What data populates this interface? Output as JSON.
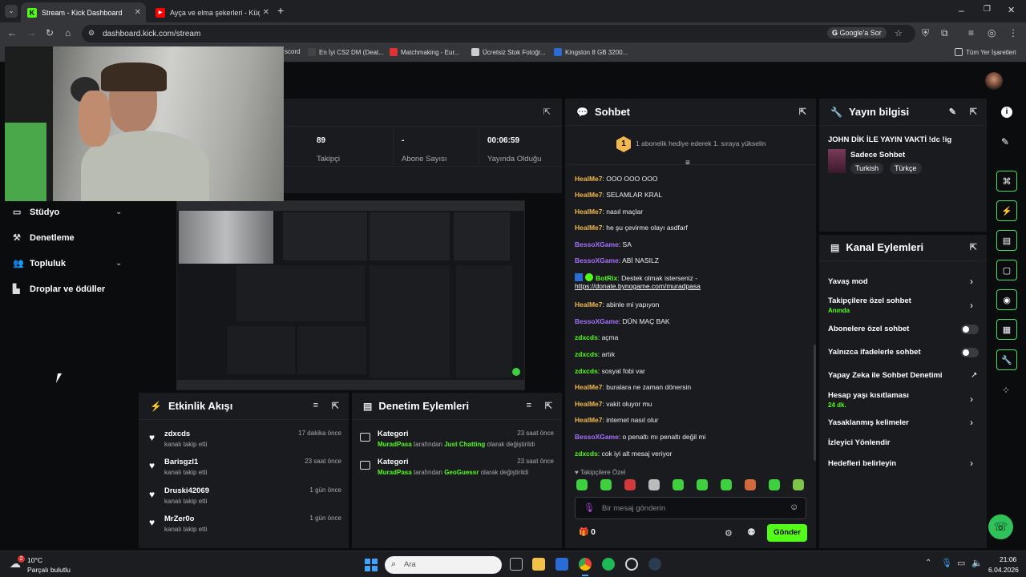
{
  "browser": {
    "tabs": [
      {
        "title": "Stream - Kick Dashboard",
        "active": true
      },
      {
        "title": "Ayça ve elma şekerleri - Küçük",
        "active": false
      }
    ],
    "new_tab": "+",
    "url": "dashboard.kick.com/stream",
    "search_engine": "Google'a Sor",
    "bookmarks": [
      "scord",
      "En İyi CS2 DM (Deat...",
      "Matchmaking - Eur...",
      "Ücretsiz Stok Fotoğr...",
      "Kingston 8 GB 3200..."
    ],
    "all_bookmarks": "Tüm Yer İşaretleri"
  },
  "sidebar": {
    "items": [
      {
        "label": "Stüdyo",
        "icon": "studio-icon"
      },
      {
        "label": "Denetleme",
        "icon": "hammer-icon"
      },
      {
        "label": "Topluluk",
        "icon": "users-icon"
      },
      {
        "label": "Droplar ve ödüller",
        "icon": "chart-icon"
      }
    ]
  },
  "stats": [
    {
      "value": "89",
      "label": "Takipçi"
    },
    {
      "value": "-",
      "label": "Abone Sayısı"
    },
    {
      "value": "00:06:59",
      "label": "Yayında Olduğu"
    }
  ],
  "chat": {
    "title": "Sohbet",
    "banner_rank": "1",
    "banner": "1 abonelik hediye ederek 1. sıraya yükselin",
    "messages": [
      {
        "user": "HealMe7",
        "color": "#f2b84b",
        "text": "OOO OOO OOO"
      },
      {
        "user": "HealMe7",
        "color": "#f2b84b",
        "text": "SELAMLAR KRAL"
      },
      {
        "user": "HealMe7",
        "color": "#f2b84b",
        "text": "nasıl maçlar"
      },
      {
        "user": "HealMe7",
        "color": "#f2b84b",
        "text": "he şu çevirme olayı asdfarf"
      },
      {
        "user": "BessoXGame",
        "color": "#a970ff",
        "text": "SA"
      },
      {
        "user": "BessoXGame",
        "color": "#a970ff",
        "text": "ABİ NASILZ"
      },
      {
        "user": "BotRix",
        "color": "#53fc18",
        "text": "Destek olmak isterseniz -",
        "link": "https://donate.bynogame.com/muradpasa"
      },
      {
        "user": "HealMe7",
        "color": "#f2b84b",
        "text": "abinle mi yapıyon"
      },
      {
        "user": "BessoXGame",
        "color": "#a970ff",
        "text": "DÜN MAÇ BAK"
      },
      {
        "user": "zdxcds",
        "color": "#53fc18",
        "text": "açma"
      },
      {
        "user": "zdxcds",
        "color": "#53fc18",
        "text": "artık"
      },
      {
        "user": "zdxcds",
        "color": "#53fc18",
        "text": "sosyal fobi var"
      },
      {
        "user": "HealMe7",
        "color": "#f2b84b",
        "text": "buralara ne zaman dönersin"
      },
      {
        "user": "HealMe7",
        "color": "#f2b84b",
        "text": "vakit oluyor mu"
      },
      {
        "user": "HealMe7",
        "color": "#f2b84b",
        "text": "internet nasıl olur"
      },
      {
        "user": "BessoXGame",
        "color": "#a970ff",
        "text": "o penaltı mı penaltı değil mi"
      },
      {
        "user": "zdxcds",
        "color": "#53fc18",
        "text": "cok iyi alt mesaj veriyor"
      }
    ],
    "followers_only": "Takipçilere Özel",
    "input_placeholder": "Bir mesaj gönderin",
    "count": "0",
    "send": "Gönder"
  },
  "stream_info": {
    "title": "Yayın bilgisi",
    "stream_title": "JOHN DİK İLE YAYIN VAKTİ !dc !ig",
    "category": "Sadece Sohbet",
    "tags": [
      "Turkish",
      "Türkçe"
    ]
  },
  "channel_actions": {
    "title": "Kanal Eylemleri",
    "items": [
      {
        "label": "Yavaş mod",
        "control": "chevron"
      },
      {
        "label": "Takipçilere özel sohbet",
        "sub": "Anında",
        "control": "chevron"
      },
      {
        "label": "Abonelere özel sohbet",
        "control": "toggle"
      },
      {
        "label": "Yalnızca ifadelerle sohbet",
        "control": "toggle"
      },
      {
        "label": "Yapay Zeka ile Sohbet Denetimi",
        "control": "external"
      },
      {
        "label": "Hesap yaşı kısıtlaması",
        "sub": "24 dk.",
        "control": "chevron"
      },
      {
        "label": "Yasaklanmış kelimeler",
        "control": "chevron"
      },
      {
        "label": "İzleyici Yönlendir",
        "control": "none"
      },
      {
        "label": "Hedefleri belirleyin",
        "control": "chevron"
      }
    ]
  },
  "activity": {
    "title": "Etkinlik Akışı",
    "items": [
      {
        "name": "zdxcds",
        "sub": "kanalı takip etti",
        "time": "17 dakika önce"
      },
      {
        "name": "Barisgzl1",
        "sub": "kanalı takip etti",
        "time": "23 saat önce"
      },
      {
        "name": "Druski42069",
        "sub": "kanalı takip etti",
        "time": "1 gün önce"
      },
      {
        "name": "MrZer0o",
        "sub": "kanalı takip etti",
        "time": "1 gün önce"
      }
    ]
  },
  "moderation": {
    "title": "Denetim Eylemleri",
    "items": [
      {
        "name": "Kategori",
        "user": "MuradPasa",
        "mid": "tarafından",
        "cat": "Just Chatting",
        "end": "olarak değiştirildi",
        "time": "23 saat önce"
      },
      {
        "name": "Kategori",
        "user": "MuradPasa",
        "mid": "tarafından",
        "cat": "GeoGuessr",
        "end": "olarak değiştirildi",
        "time": "23 saat önce"
      }
    ]
  },
  "taskbar": {
    "weather_temp": "10°C",
    "weather_desc": "Parçalı bulutlu",
    "weather_badge": "2",
    "search": "Ara",
    "time": "21:06",
    "date": "6.04.2026"
  },
  "colors": {
    "accent": "#53fc18",
    "panel": "#191b1f",
    "bg": "#0b0c0e"
  }
}
